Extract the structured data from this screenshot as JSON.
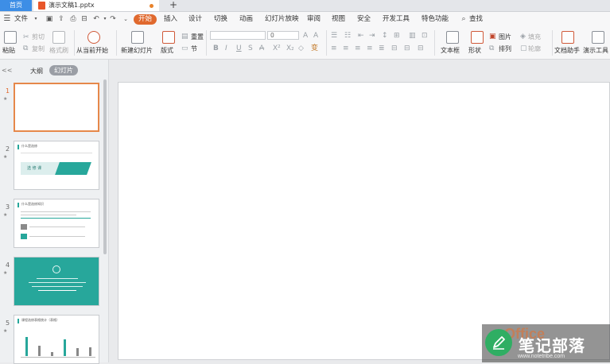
{
  "tabs": {
    "home": "首页",
    "document": "演示文稿1.pptx",
    "add": "+"
  },
  "menu": {
    "file": "文件",
    "items": [
      "开始",
      "插入",
      "设计",
      "切换",
      "动画",
      "幻灯片放映",
      "审阅",
      "视图",
      "安全",
      "开发工具",
      "特色功能"
    ],
    "search": "查找"
  },
  "ribbon": {
    "paste": "粘贴",
    "cut": "剪切",
    "copy": "复制",
    "format_painter": "格式刷",
    "from_current": "从当前开始",
    "new_slide": "新建幻灯片",
    "layout": "版式",
    "reset": "重置",
    "section": "节",
    "font_size": "0",
    "textbox": "文本框",
    "shape": "形状",
    "picture": "图片",
    "arrange": "排列",
    "fill": "填充",
    "outline": "轮廓",
    "doc_helper": "文档助手",
    "presentation_tools": "演示工具"
  },
  "panel": {
    "collapse": "<<",
    "outline_tab": "大纲",
    "slides_tab": "幻灯片",
    "slides": [
      {
        "num": "1",
        "title": "",
        "subtitle": ""
      },
      {
        "num": "2",
        "title": "什么是选修",
        "subtitle": "选 修 课"
      },
      {
        "num": "3",
        "title": "什么是选修知识",
        "subtitle": ""
      },
      {
        "num": "4",
        "title": "",
        "subtitle": ""
      },
      {
        "num": "5",
        "title": "课程选修表格统计（表格）",
        "subtitle": ""
      }
    ]
  },
  "watermark": {
    "office": "Office",
    "site_name": "笔记部落",
    "url": "www.notetribe.com"
  },
  "colors": {
    "accent": "#e0692e",
    "home_tab": "#3d8ee6",
    "teal": "#27a79b"
  }
}
